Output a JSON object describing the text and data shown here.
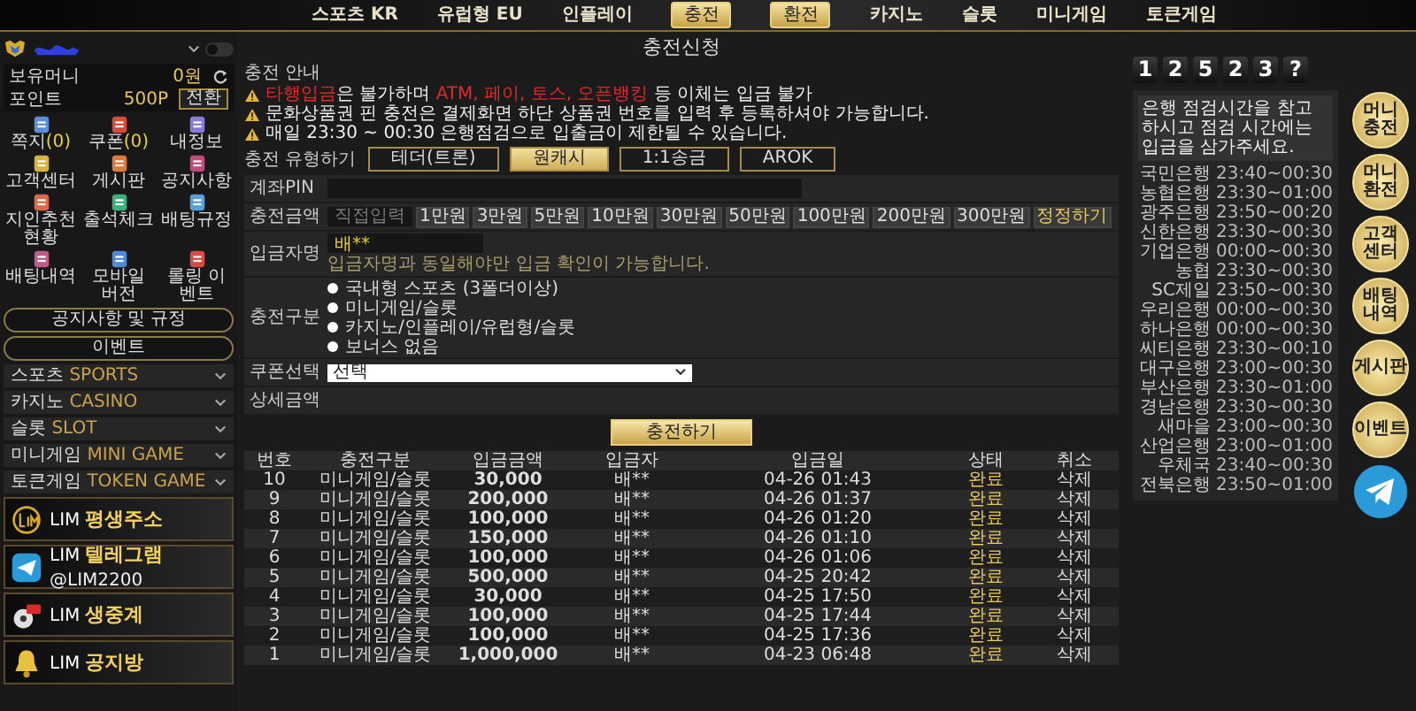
{
  "nav": [
    {
      "label": "스포츠 KR",
      "kind": "link"
    },
    {
      "label": "유럽형 EU",
      "kind": "link"
    },
    {
      "label": "인플레이",
      "kind": "link"
    },
    {
      "label": "충전",
      "kind": "button"
    },
    {
      "label": "환전",
      "kind": "button"
    },
    {
      "label": "카지노",
      "kind": "link"
    },
    {
      "label": "슬롯",
      "kind": "link"
    },
    {
      "label": "미니게임",
      "kind": "link"
    },
    {
      "label": "토큰게임",
      "kind": "link"
    }
  ],
  "user": {
    "toggle_on": false,
    "money_label": "보유머니",
    "money": "0원",
    "point_label": "포인트",
    "point": "500P",
    "convert": "전환"
  },
  "shortcuts": [
    {
      "label": "쪽지",
      "count": "(0)"
    },
    {
      "label": "쿠폰",
      "count": "(0)"
    },
    {
      "label": "내정보"
    },
    {
      "label": "고객센터"
    },
    {
      "label": "게시판"
    },
    {
      "label": "공지사항"
    },
    {
      "label": "지인추천현황"
    },
    {
      "label": "출석체크"
    },
    {
      "label": "배팅규정"
    },
    {
      "label": "배팅내역"
    },
    {
      "label": "모바일 버전"
    },
    {
      "label": "롤링 이벤트"
    }
  ],
  "side_buttons": [
    "공지사항 및 규정",
    "이벤트"
  ],
  "menu": [
    {
      "label": "스포츠",
      "sub": "SPORTS"
    },
    {
      "label": "카지노",
      "sub": "CASINO"
    },
    {
      "label": "슬롯",
      "sub": "SLOT"
    },
    {
      "label": "미니게임",
      "sub": "MINI GAME"
    },
    {
      "label": "토큰게임",
      "sub": "TOKEN GAME"
    }
  ],
  "banners": [
    {
      "kind": "address",
      "brand": "LIM",
      "title": "평생주소"
    },
    {
      "kind": "telegram",
      "brand": "LIM",
      "title": "텔레그램",
      "sub": "@LIM2200"
    },
    {
      "kind": "live",
      "brand": "LIM",
      "title": "생중계"
    },
    {
      "kind": "bell",
      "brand": "LIM",
      "title": "공지방"
    }
  ],
  "page_title": "충전신청",
  "notice": {
    "title": "충전 안내",
    "items": [
      [
        {
          "text": "타행입금",
          "highlight": true
        },
        {
          "text": "은 불가하며 ",
          "highlight": false
        },
        {
          "text": "ATM, 페이, 토스, 오픈뱅킹",
          "highlight": true
        },
        {
          "text": " 등 이체는 입금 불가",
          "highlight": false
        }
      ],
      [
        {
          "text": "문화상품권 핀 충전은 결제화면 하단 상품권 번호를 입력 후 등록하셔야 가능합니다.",
          "highlight": false
        }
      ],
      [
        {
          "text": "매일 23:30 ~ 00:30 은행점검으로 입출금이 제한될 수 있습니다.",
          "highlight": false
        }
      ]
    ]
  },
  "charge_types": {
    "label": "충전 유형하기",
    "items": [
      {
        "label": "테더(트론)",
        "selected": false
      },
      {
        "label": "원캐시",
        "selected": true
      },
      {
        "label": "1:1송금",
        "selected": false
      },
      {
        "label": "AROK",
        "selected": false
      }
    ]
  },
  "form": {
    "account_label": "계좌PIN",
    "amount_label": "충전금액",
    "amount_placeholder": "직접입력",
    "amounts": [
      "1만원",
      "3만원",
      "5만원",
      "10만원",
      "30만원",
      "50만원",
      "100만원",
      "200만원",
      "300만원"
    ],
    "amount_reset": "정정하기",
    "depositor_label": "입금자명",
    "depositor": "배**",
    "depositor_hint": "입금자명과 동일해야만 입금 확인이 가능합니다.",
    "type_label": "충전구분",
    "types": [
      {
        "label": "국내형 스포츠 (3폴더이상)",
        "selected": false
      },
      {
        "label": "미니게임/슬롯",
        "selected": false
      },
      {
        "label": "카지노/인플레이/유럽형/슬롯",
        "selected": false
      },
      {
        "label": "보너스 없음",
        "selected": false
      }
    ],
    "coupon_label": "쿠폰선택",
    "coupon": "선택",
    "detail_label": "상세금액",
    "submit": "충전하기"
  },
  "history": {
    "columns": [
      "번호",
      "충전구분",
      "입금금액",
      "입금자",
      "입금일",
      "상태",
      "취소"
    ],
    "rows": [
      [
        "10",
        "미니게임/슬롯",
        "30,000",
        "배**",
        "04-26 01:43",
        "완료",
        "삭제"
      ],
      [
        "9",
        "미니게임/슬롯",
        "200,000",
        "배**",
        "04-26 01:37",
        "완료",
        "삭제"
      ],
      [
        "8",
        "미니게임/슬롯",
        "100,000",
        "배**",
        "04-26 01:20",
        "완료",
        "삭제"
      ],
      [
        "7",
        "미니게임/슬롯",
        "150,000",
        "배**",
        "04-26 01:10",
        "완료",
        "삭제"
      ],
      [
        "6",
        "미니게임/슬롯",
        "100,000",
        "배**",
        "04-26 01:06",
        "완료",
        "삭제"
      ],
      [
        "5",
        "미니게임/슬롯",
        "500,000",
        "배**",
        "04-25 20:42",
        "완료",
        "삭제"
      ],
      [
        "4",
        "미니게임/슬롯",
        "30,000",
        "배**",
        "04-25 17:50",
        "완료",
        "삭제"
      ],
      [
        "3",
        "미니게임/슬롯",
        "100,000",
        "배**",
        "04-25 17:44",
        "완료",
        "삭제"
      ],
      [
        "2",
        "미니게임/슬롯",
        "100,000",
        "배**",
        "04-25 17:36",
        "완료",
        "삭제"
      ],
      [
        "1",
        "미니게임/슬롯",
        "1,000,000",
        "배**",
        "04-23 06:48",
        "완료",
        "삭제"
      ]
    ]
  },
  "counter": [
    "1",
    "2",
    "5",
    "2",
    "3",
    "?"
  ],
  "bank_hours": {
    "note": "은행 점검시간을 참고하시고 점검 시간에는 입금을 삼가주세요.",
    "rows": [
      {
        "bank": "국민은행",
        "time": "23:40~00:30"
      },
      {
        "bank": "농협은행",
        "time": "23:30~01:00"
      },
      {
        "bank": "광주은행",
        "time": "23:50~00:20"
      },
      {
        "bank": "신한은행",
        "time": "23:30~00:30"
      },
      {
        "bank": "기업은행",
        "time": "00:00~00:30"
      },
      {
        "bank": "농협",
        "time": "23:30~00:30"
      },
      {
        "bank": "SC제일",
        "time": "23:50~00:30"
      },
      {
        "bank": "우리은행",
        "time": "00:00~00:30"
      },
      {
        "bank": "하나은행",
        "time": "00:00~00:30"
      },
      {
        "bank": "씨티은행",
        "time": "23:30~00:10"
      },
      {
        "bank": "대구은행",
        "time": "23:00~00:30"
      },
      {
        "bank": "부산은행",
        "time": "23:30~01:00"
      },
      {
        "bank": "경남은행",
        "time": "23:30~00:30"
      },
      {
        "bank": "새마을",
        "time": "23:00~00:30"
      },
      {
        "bank": "산업은행",
        "time": "23:00~01:00"
      },
      {
        "bank": "우체국",
        "time": "23:40~00:30"
      },
      {
        "bank": "전북은행",
        "time": "23:50~01:00"
      }
    ]
  },
  "quick": [
    {
      "kind": "text",
      "label": "머니 충전"
    },
    {
      "kind": "text",
      "label": "머니 환전"
    },
    {
      "kind": "text",
      "label": "고객 센터"
    },
    {
      "kind": "text",
      "label": "배팅 내역"
    },
    {
      "kind": "text",
      "label": "게시판"
    },
    {
      "kind": "text",
      "label": "이벤트"
    },
    {
      "kind": "telegram"
    }
  ]
}
